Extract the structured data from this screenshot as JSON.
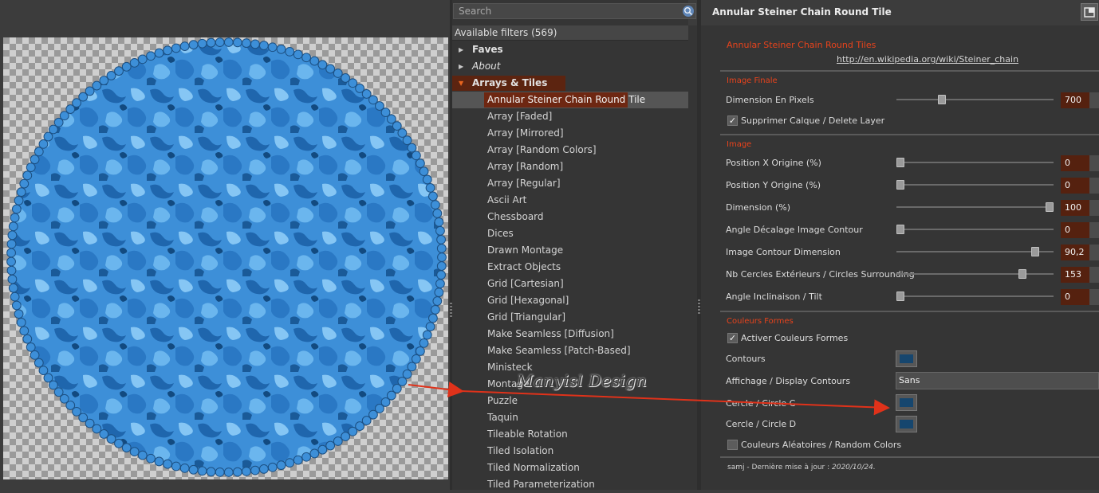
{
  "search": {
    "placeholder": "Search"
  },
  "filters": {
    "header": "Available filters (569)",
    "folders": [
      {
        "label": "Faves",
        "state": "collapsed"
      },
      {
        "label": "About",
        "state": "collapsed"
      },
      {
        "label": "Arrays & Tiles",
        "state": "expanded"
      }
    ],
    "items": [
      "Annular Steiner Chain Round Tile",
      "Array [Faded]",
      "Array [Mirrored]",
      "Array [Random Colors]",
      "Array [Random]",
      "Array [Regular]",
      "Ascii Art",
      "Chessboard",
      "Dices",
      "Drawn Montage",
      "Extract Objects",
      "Grid [Cartesian]",
      "Grid [Hexagonal]",
      "Grid [Triangular]",
      "Make Seamless [Diffusion]",
      "Make Seamless [Patch-Based]",
      "Ministeck",
      "Montage",
      "Puzzle",
      "Taquin",
      "Tileable Rotation",
      "Tiled Isolation",
      "Tiled Normalization",
      "Tiled Parameterization"
    ],
    "selected_index": 0
  },
  "params": {
    "title": "Annular Steiner Chain Round Tile",
    "heading": "Annular Steiner Chain Round Tiles",
    "link": "http://en.wikipedia.org/wiki/Steiner_chain",
    "sections": {
      "image_finale": "Image Finale",
      "image": "Image",
      "couleurs": "Couleurs Formes"
    },
    "dimension_pixels": {
      "label": "Dimension En Pixels",
      "value": "700",
      "fraction": 0.28
    },
    "delete_layer": {
      "label": "Supprimer Calque / Delete Layer",
      "checked": true
    },
    "pos_x": {
      "label": "Position X Origine (%)",
      "value": "0",
      "fraction": 0.0
    },
    "pos_y": {
      "label": "Position Y Origine (%)",
      "value": "0",
      "fraction": 0.0
    },
    "dimension_pct": {
      "label": "Dimension (%)",
      "value": "100",
      "fraction": 1.0
    },
    "angle_decalage": {
      "label": "Angle Décalage Image Contour",
      "value": "0",
      "fraction": 0.0
    },
    "contour_dimension": {
      "label": "Image Contour Dimension",
      "value": "90,2",
      "fraction": 0.902
    },
    "nb_cercles": {
      "label": "Nb Cercles Extérieurs / Circles Surrounding",
      "value": "153",
      "fraction": 0.82
    },
    "angle_tilt": {
      "label": "Angle Inclinaison / Tilt",
      "value": "0",
      "fraction": 0.0
    },
    "activer_couleurs": {
      "label": "Activer Couleurs Formes",
      "checked": true
    },
    "contours": {
      "label": "Contours",
      "color": "#16466e"
    },
    "affichage": {
      "label": "Affichage / Display Contours",
      "value": "Sans"
    },
    "cercle_c": {
      "label": "Cercle / Circle C",
      "color": "#16466e"
    },
    "cercle_d": {
      "label": "Cercle / Circle D",
      "color": "#16466e"
    },
    "random_colors": {
      "label": "Couleurs Aléatoires / Random Colors",
      "checked": false
    },
    "footer": {
      "prefix": "samj - Dernière mise à jour : ",
      "date": "2020/10/24."
    }
  },
  "watermark": "Manyisl Design",
  "colors": {
    "accent_red": "#e8431c",
    "selection": "#6e2712",
    "tile_blue": "#3d8fd8",
    "arrow_red": "#e0321a"
  }
}
